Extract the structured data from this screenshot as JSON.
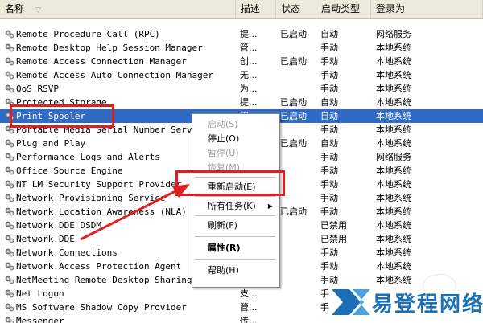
{
  "header": {
    "name": "名称",
    "desc": "描述",
    "status": "状态",
    "startup": "启动类型",
    "logon": "登录为"
  },
  "rows": [
    {
      "name": "Remote Procedure Call (RPC)",
      "desc": "提...",
      "status": "已启动",
      "startup": "自动",
      "logon": "网络服务"
    },
    {
      "name": "Remote Desktop Help Session Manager",
      "desc": "管...",
      "status": "",
      "startup": "手动",
      "logon": "本地系统"
    },
    {
      "name": "Remote Access Connection Manager",
      "desc": "创...",
      "status": "已启动",
      "startup": "手动",
      "logon": "本地系统"
    },
    {
      "name": "Remote Access Auto Connection Manager",
      "desc": "无...",
      "status": "",
      "startup": "手动",
      "logon": "本地系统"
    },
    {
      "name": "QoS RSVP",
      "desc": "为...",
      "status": "",
      "startup": "手动",
      "logon": "本地系统"
    },
    {
      "name": "Protected Storage",
      "desc": "提...",
      "status": "已启动",
      "startup": "自动",
      "logon": "本地系统"
    },
    {
      "name": "Print Spooler",
      "desc": "将...",
      "status": "已启动",
      "startup": "自动",
      "logon": "本地系统"
    },
    {
      "name": "Portable Media Serial Number Service",
      "desc": "",
      "status": "",
      "startup": "手动",
      "logon": "本地系统"
    },
    {
      "name": "Plug and Play",
      "desc": "",
      "status": "已启动",
      "startup": "自动",
      "logon": "本地系统"
    },
    {
      "name": "Performance Logs and Alerts",
      "desc": "",
      "status": "",
      "startup": "手动",
      "logon": "网络服务"
    },
    {
      "name": "Office Source Engine",
      "desc": "",
      "status": "",
      "startup": "手动",
      "logon": "本地系统"
    },
    {
      "name": "NT LM Security Support Provider",
      "desc": "",
      "status": "",
      "startup": "手动",
      "logon": "本地系统"
    },
    {
      "name": "Network Provisioning Service",
      "desc": "",
      "status": "",
      "startup": "手动",
      "logon": "本地系统"
    },
    {
      "name": "Network Location Awareness (NLA)",
      "desc": "",
      "status": "已启动",
      "startup": "手动",
      "logon": "本地系统"
    },
    {
      "name": "Network DDE DSDM",
      "desc": "",
      "status": "",
      "startup": "已禁用",
      "logon": "本地系统"
    },
    {
      "name": "Network DDE",
      "desc": "",
      "status": "",
      "startup": "已禁用",
      "logon": "本地系统"
    },
    {
      "name": "Network Connections",
      "desc": "",
      "status": "",
      "startup": "手动",
      "logon": "本地系统"
    },
    {
      "name": "Network Access Protection Agent",
      "desc": "",
      "status": "",
      "startup": "手动",
      "logon": "本地系统"
    },
    {
      "name": "NetMeeting Remote Desktop Sharing",
      "desc": "使...",
      "status": "",
      "startup": "手动",
      "logon": "本地系统"
    },
    {
      "name": "Net Logon",
      "desc": "支...",
      "status": "",
      "startup": "手",
      "logon": ""
    },
    {
      "name": "MS Software Shadow Copy Provider",
      "desc": "管...",
      "status": "",
      "startup": "手",
      "logon": ""
    },
    {
      "name": "Messenger",
      "desc": "传...",
      "status": "",
      "startup": "",
      "logon": ""
    }
  ],
  "selected_row": 6,
  "context_menu": {
    "items": [
      {
        "label": "启动(S)",
        "disabled": true
      },
      {
        "label": "停止(O)",
        "disabled": false
      },
      {
        "label": "暂停(U)",
        "disabled": true
      },
      {
        "label": "恢复(M)",
        "disabled": true
      },
      {
        "label": "重新启动(E)",
        "disabled": false
      },
      {
        "label": "所有任务(K)",
        "disabled": false,
        "submenu": true
      },
      {
        "label": "刷新(F)",
        "disabled": false
      },
      {
        "label": "属性(R)",
        "disabled": false,
        "bold": true
      },
      {
        "label": "帮助(H)",
        "disabled": false
      }
    ]
  },
  "watermark": {
    "text": "易登程网络"
  },
  "colors": {
    "selection": "#316ac5",
    "highlight": "#e0201e",
    "header_bg": "#ebeadb",
    "watermark": "#1d6fb8"
  }
}
